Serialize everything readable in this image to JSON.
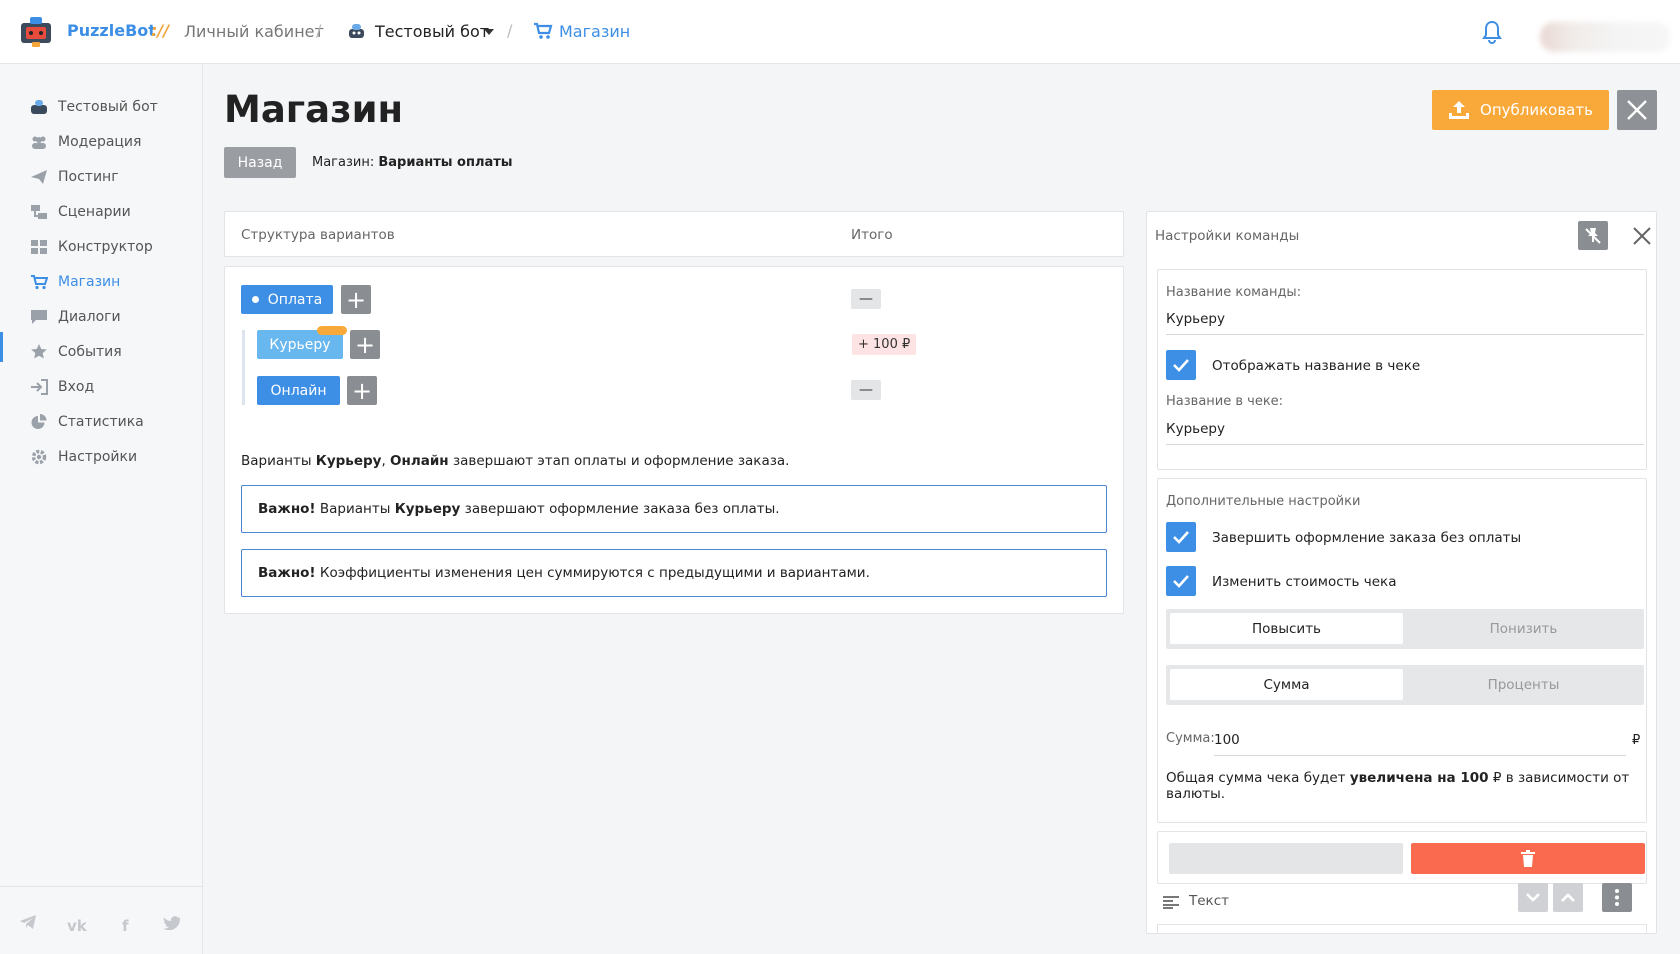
{
  "topbar": {
    "brand": "PuzzleBot",
    "brand_sep": "://",
    "cabinet": "Личный кабинет",
    "bot_name": "Тестовый бот",
    "shop": "Магазин"
  },
  "sidebar": {
    "items": [
      {
        "label": "Тестовый бот",
        "icon": "bot-icon"
      },
      {
        "label": "Модерация",
        "icon": "users-icon"
      },
      {
        "label": "Постинг",
        "icon": "paper-plane-icon"
      },
      {
        "label": "Сценарии",
        "icon": "scenario-icon"
      },
      {
        "label": "Конструктор",
        "icon": "grid-icon"
      },
      {
        "label": "Магазин",
        "icon": "cart-icon"
      },
      {
        "label": "Диалоги",
        "icon": "chat-icon"
      },
      {
        "label": "События",
        "icon": "star-icon"
      },
      {
        "label": "Вход",
        "icon": "login-icon"
      },
      {
        "label": "Статистика",
        "icon": "pie-chart-icon"
      },
      {
        "label": "Настройки",
        "icon": "gear-icon"
      }
    ],
    "active_index": 5,
    "social": [
      "telegram-icon",
      "vk-icon",
      "facebook-icon",
      "twitter-icon"
    ]
  },
  "main": {
    "title": "Магазин",
    "back": "Назад",
    "crumb_prefix": "Магазин:",
    "crumb_current": "Варианты оплаты",
    "publish": "Опубликовать"
  },
  "structure": {
    "col_structure": "Структура вариантов",
    "col_total": "Итого",
    "root": {
      "label": "Оплата",
      "total": "—"
    },
    "children": [
      {
        "label": "Курьеру",
        "total": "+ 100 ₽"
      },
      {
        "label": "Онлайн",
        "total": "—"
      }
    ],
    "note_prefix": "Варианты",
    "note_v1": "Курьеру",
    "note_comma": ",",
    "note_v2": "Онлайн",
    "note_suffix": "завершают этап оплаты и оформление заказа.",
    "alert1_bold": "Важно!",
    "alert1_a": "Варианты",
    "alert1_b": "Курьеру",
    "alert1_c": "завершают оформление заказа без оплаты.",
    "alert2_bold": "Важно!",
    "alert2_text": "Коэффициенты изменения цен суммируются с предыдущими и вариантами."
  },
  "settings": {
    "title": "Настройки команды",
    "name_label": "Название команды:",
    "name_value": "Курьеру",
    "show_in_receipt": "Отображать название в чеке",
    "receipt_label": "Название в чеке:",
    "receipt_value": "Курьеру",
    "extra_title": "Дополнительные настройки",
    "finish_no_pay": "Завершить оформление заказа без оплаты",
    "change_cost": "Изменить стоимость чека",
    "seg1": [
      "Повысить",
      "Понизить"
    ],
    "seg2": [
      "Сумма",
      "Проценты"
    ],
    "sum_label": "Сумма:",
    "sum_value": "100",
    "sum_unit": "₽",
    "sum_note_a": "Общая сумма чека будет",
    "sum_note_b": "увеличена на 100",
    "sum_note_c": "₽ в зависимости от валюты.",
    "text_block": "Текст"
  },
  "colors": {
    "accent": "#3d8fe6",
    "publish": "#f8a93a",
    "delete": "#fa6a4f",
    "price_badge_bg": "#fde3e3"
  }
}
